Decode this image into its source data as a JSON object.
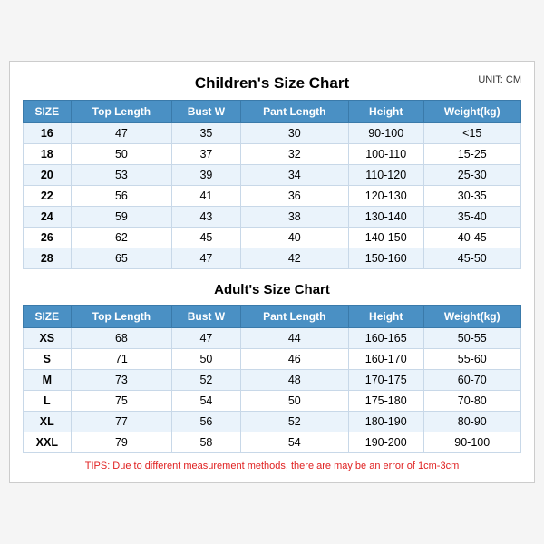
{
  "page": {
    "main_title": "Children's Size Chart",
    "unit": "UNIT: CM",
    "children_headers": [
      "SIZE",
      "Top Length",
      "Bust W",
      "Pant Length",
      "Height",
      "Weight(kg)"
    ],
    "children_rows": [
      [
        "16",
        "47",
        "35",
        "30",
        "90-100",
        "<15"
      ],
      [
        "18",
        "50",
        "37",
        "32",
        "100-110",
        "15-25"
      ],
      [
        "20",
        "53",
        "39",
        "34",
        "110-120",
        "25-30"
      ],
      [
        "22",
        "56",
        "41",
        "36",
        "120-130",
        "30-35"
      ],
      [
        "24",
        "59",
        "43",
        "38",
        "130-140",
        "35-40"
      ],
      [
        "26",
        "62",
        "45",
        "40",
        "140-150",
        "40-45"
      ],
      [
        "28",
        "65",
        "47",
        "42",
        "150-160",
        "45-50"
      ]
    ],
    "adult_title": "Adult's Size Chart",
    "adult_headers": [
      "SIZE",
      "Top Length",
      "Bust W",
      "Pant Length",
      "Height",
      "Weight(kg)"
    ],
    "adult_rows": [
      [
        "XS",
        "68",
        "47",
        "44",
        "160-165",
        "50-55"
      ],
      [
        "S",
        "71",
        "50",
        "46",
        "160-170",
        "55-60"
      ],
      [
        "M",
        "73",
        "52",
        "48",
        "170-175",
        "60-70"
      ],
      [
        "L",
        "75",
        "54",
        "50",
        "175-180",
        "70-80"
      ],
      [
        "XL",
        "77",
        "56",
        "52",
        "180-190",
        "80-90"
      ],
      [
        "XXL",
        "79",
        "58",
        "54",
        "190-200",
        "90-100"
      ]
    ],
    "tips": "TIPS: Due to different measurement methods, there are may be an error of 1cm-3cm"
  }
}
